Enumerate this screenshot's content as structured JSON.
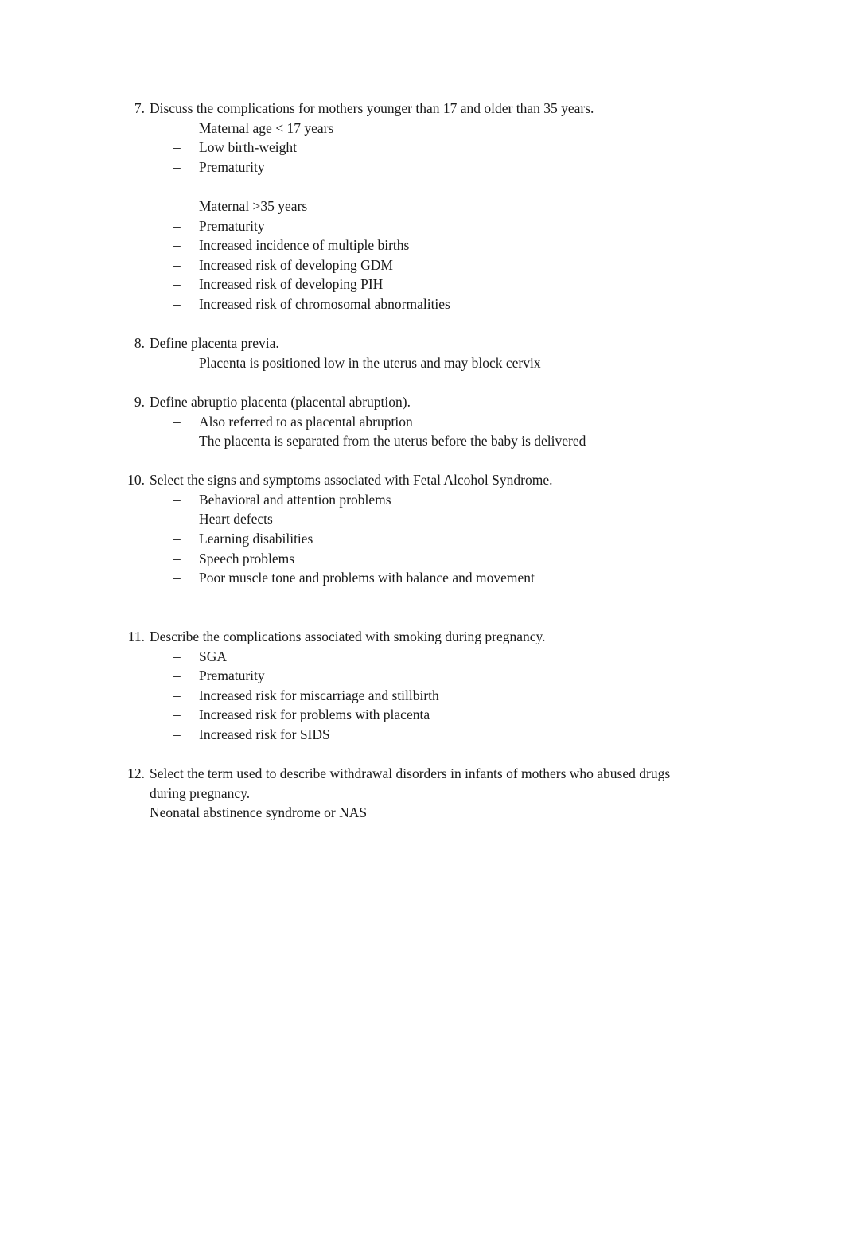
{
  "document": {
    "bullet_marker": "–",
    "text_color": "#1a1a1a",
    "page_background": "#ffffff",
    "items": [
      {
        "number": "7.",
        "text": "Discuss the complications for mothers younger than 17 and older than 35 years.",
        "sub_head_1": "Maternal age < 17 years",
        "bullets_1": [
          "Low birth-weight",
          "Prematurity"
        ],
        "sub_head_2": "Maternal >35 years",
        "bullets_2": [
          "Prematurity",
          "Increased incidence of multiple births",
          "Increased risk of developing GDM",
          "Increased risk of developing PIH",
          "Increased risk of chromosomal abnormalities"
        ]
      },
      {
        "number": "8.",
        "text": "Define placenta previa.",
        "bullets": [
          "Placenta is positioned low in the uterus and may block cervix"
        ]
      },
      {
        "number": "9.",
        "text": "Define abruptio placenta (placental abruption).",
        "bullets": [
          "Also referred to as placental abruption",
          "The placenta is separated from the uterus before the baby is delivered"
        ]
      },
      {
        "number": "10.",
        "text": "Select the signs and symptoms associated with Fetal Alcohol Syndrome.",
        "bullets": [
          "Behavioral and attention problems",
          "Heart defects",
          "Learning disabilities",
          "Speech problems",
          "Poor muscle tone and problems with balance and movement"
        ]
      },
      {
        "number": "11.",
        "text": "Describe the complications associated with smoking during pregnancy.",
        "bullets": [
          "SGA",
          "Prematurity",
          "Increased risk for miscarriage and stillbirth",
          "Increased risk for problems with placenta",
          "Increased risk for SIDS"
        ]
      },
      {
        "number": "12.",
        "text": "Select the term used to describe withdrawal disorders in infants of mothers who abused drugs during pregnancy.",
        "answer": "Neonatal abstinence syndrome or NAS"
      }
    ]
  }
}
